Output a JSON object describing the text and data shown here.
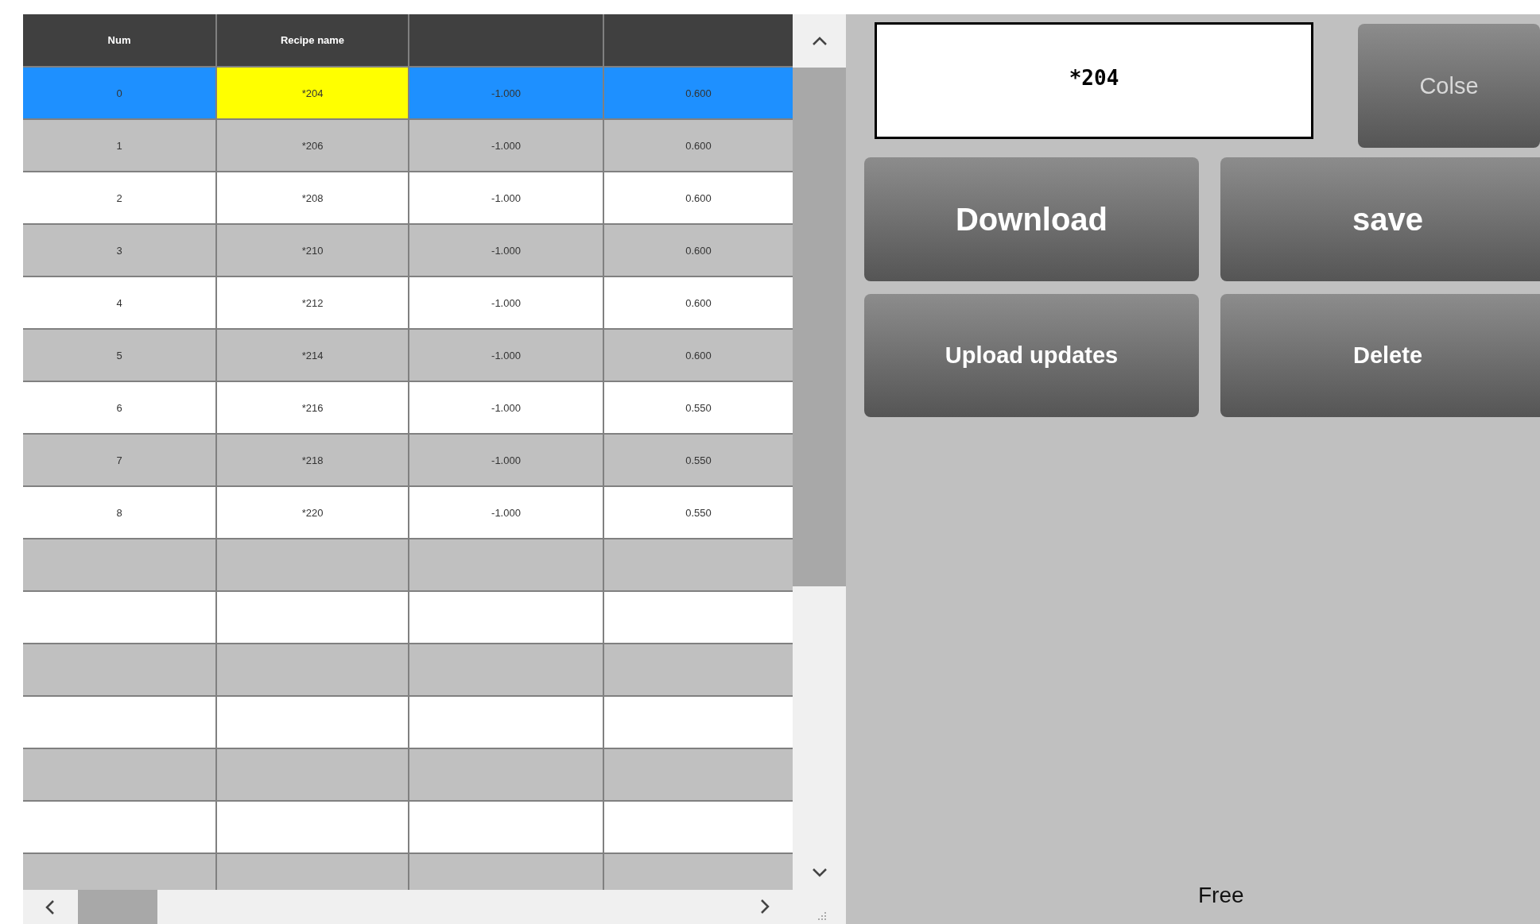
{
  "table": {
    "columns": [
      "Num",
      "Recipe name",
      "",
      ""
    ],
    "rows": [
      {
        "selected": true,
        "cells": [
          "0",
          "*204",
          "-1.000",
          "0.600"
        ]
      },
      {
        "selected": false,
        "cells": [
          "1",
          "*206",
          "-1.000",
          "0.600"
        ]
      },
      {
        "selected": false,
        "cells": [
          "2",
          "*208",
          "-1.000",
          "0.600"
        ]
      },
      {
        "selected": false,
        "cells": [
          "3",
          "*210",
          "-1.000",
          "0.600"
        ]
      },
      {
        "selected": false,
        "cells": [
          "4",
          "*212",
          "-1.000",
          "0.600"
        ]
      },
      {
        "selected": false,
        "cells": [
          "5",
          "*214",
          "-1.000",
          "0.600"
        ]
      },
      {
        "selected": false,
        "cells": [
          "6",
          "*216",
          "-1.000",
          "0.550"
        ]
      },
      {
        "selected": false,
        "cells": [
          "7",
          "*218",
          "-1.000",
          "0.550"
        ]
      },
      {
        "selected": false,
        "cells": [
          "8",
          "*220",
          "-1.000",
          "0.550"
        ]
      }
    ]
  },
  "name_field": {
    "value": "*204"
  },
  "close_button": "Colse",
  "buttons": [
    {
      "label": "Download",
      "kind": "large"
    },
    {
      "label": "save",
      "kind": "large"
    },
    {
      "label": "Upload updates",
      "kind": "small"
    },
    {
      "label": "Delete",
      "kind": "small"
    }
  ],
  "status": "Free"
}
